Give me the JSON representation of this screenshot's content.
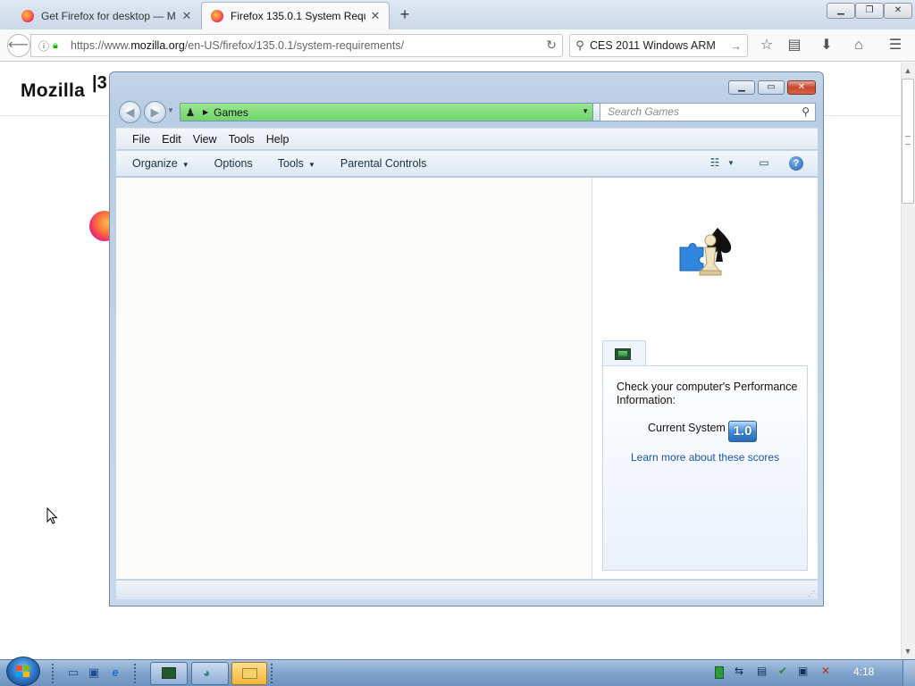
{
  "browser": {
    "tabs": [
      {
        "title": "Get Firefox for desktop — M",
        "active": false
      },
      {
        "title": "Firefox 135.0.1 System Requi",
        "active": true
      }
    ],
    "url": {
      "scheme": "https://www.",
      "host": "mozilla.org",
      "path": "/en-US/firefox/135.0.1/system-requirements/"
    },
    "search_value": "CES 2011 Windows ARM",
    "icons": [
      "back-icon",
      "info-icon",
      "lock-icon",
      "reload-icon",
      "search-icon",
      "go-arrow-icon",
      "bookmark-star-icon",
      "reading-list-icon",
      "download-icon",
      "home-icon",
      "menu-icon"
    ]
  },
  "page": {
    "logo_text": "Mozilla",
    "logo_fragment": "|3"
  },
  "explorer": {
    "breadcrumb": "Games",
    "search_placeholder": "Search Games",
    "menu": [
      "File",
      "Edit",
      "View",
      "Tools",
      "Help"
    ],
    "toolbar": {
      "organize": "Organize",
      "options": "Options",
      "tools": "Tools",
      "parental": "Parental Controls"
    },
    "perf": {
      "message": "Check your computer's Performance Information:",
      "current_label": "Current System",
      "score": "1.0",
      "learn_link": "Learn more about these scores"
    }
  },
  "taskbar": {
    "clock": "4:18"
  }
}
